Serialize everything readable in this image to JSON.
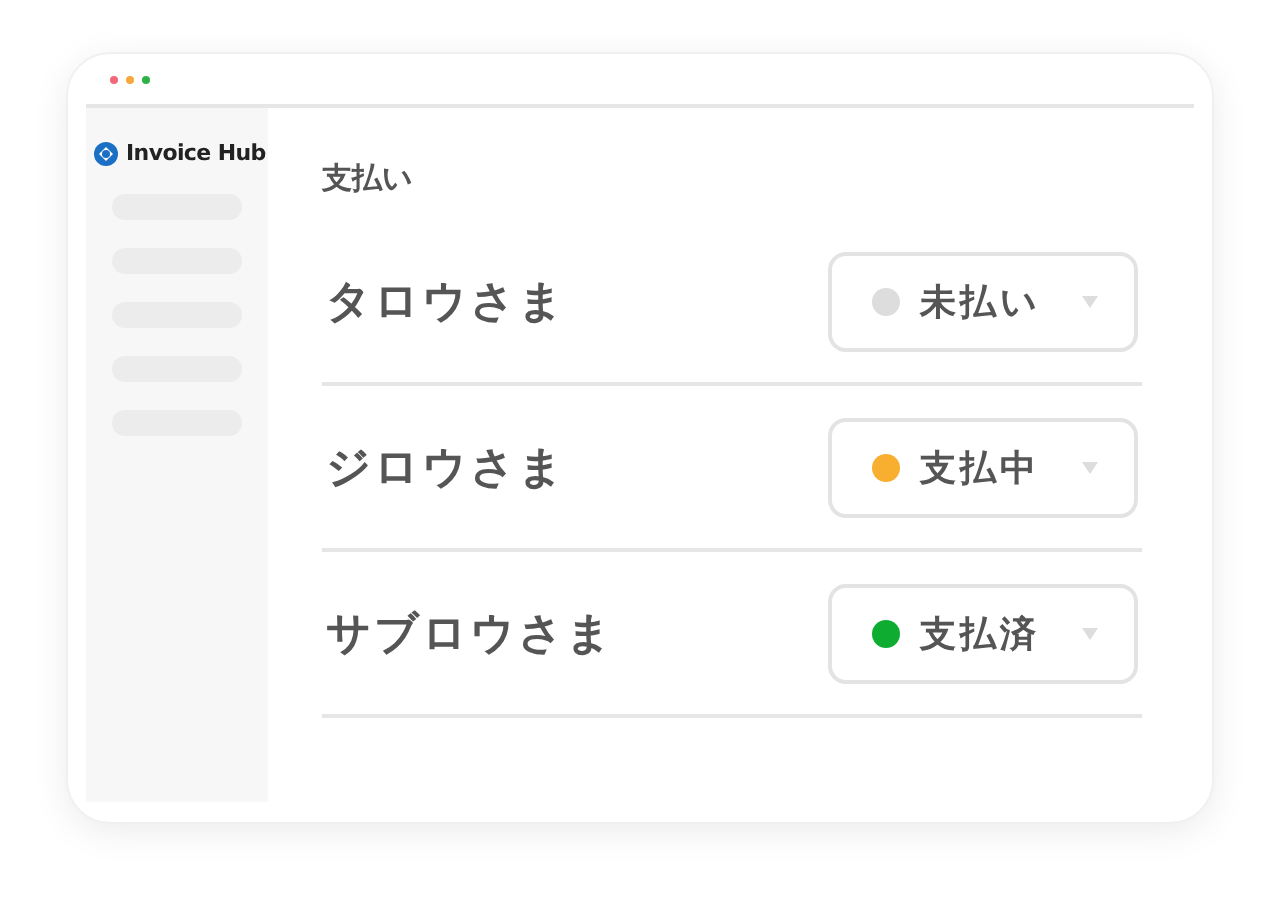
{
  "window": {
    "brand": "Invoice Hub"
  },
  "page": {
    "title": "支払い"
  },
  "payments": [
    {
      "name": "タロウさま",
      "status": "未払い",
      "color": "#dddddd"
    },
    {
      "name": "ジロウさま",
      "status": "支払中",
      "color": "#f8ae2e"
    },
    {
      "name": "サブロウさま",
      "status": "支払済",
      "color": "#0ead32"
    }
  ]
}
